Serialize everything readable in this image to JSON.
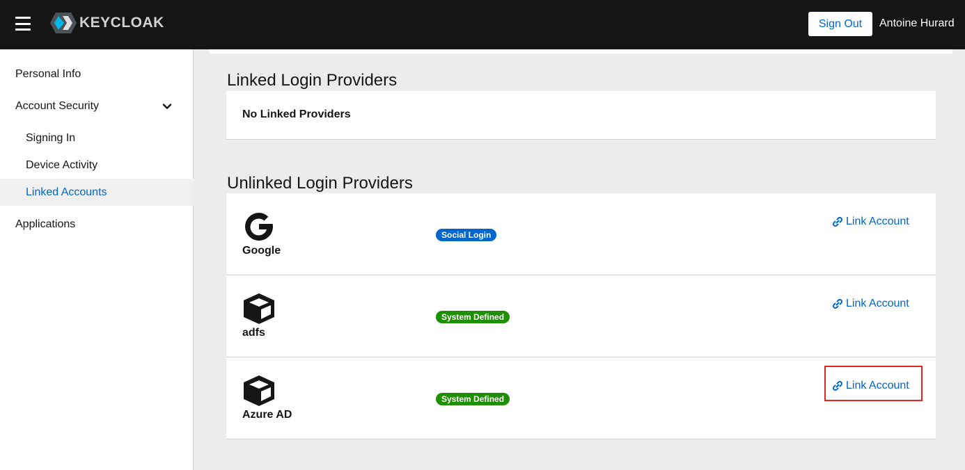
{
  "header": {
    "menu_icon": "hamburger-icon",
    "logo_text": "KEYCLOAK",
    "sign_out_label": "Sign Out",
    "user_name": "Antoine Hurard"
  },
  "sidebar": {
    "items": [
      {
        "label": "Personal Info"
      },
      {
        "label": "Account Security",
        "icon": "chevron-down-icon"
      },
      {
        "label": "Signing In"
      },
      {
        "label": "Device Activity"
      },
      {
        "label": "Linked Accounts",
        "active": true
      },
      {
        "label": "Applications"
      }
    ]
  },
  "linked": {
    "title": "Linked Login Providers",
    "empty_text": "No Linked Providers"
  },
  "unlinked": {
    "title": "Unlinked Login Providers",
    "providers": [
      {
        "name": "Google",
        "icon": "google-icon",
        "badge": "Social Login",
        "action": "Link Account"
      },
      {
        "name": "adfs",
        "icon": "cube-icon",
        "badge": "System Defined",
        "action": "Link Account"
      },
      {
        "name": "Azure AD",
        "icon": "cube-icon",
        "badge": "System Defined",
        "action": "Link Account"
      }
    ]
  },
  "colors": {
    "header_bg": "#151515",
    "accent": "#0066cc",
    "badge_social": "#0066cc",
    "badge_system": "#1e8f00",
    "highlight": "#e3261d"
  }
}
